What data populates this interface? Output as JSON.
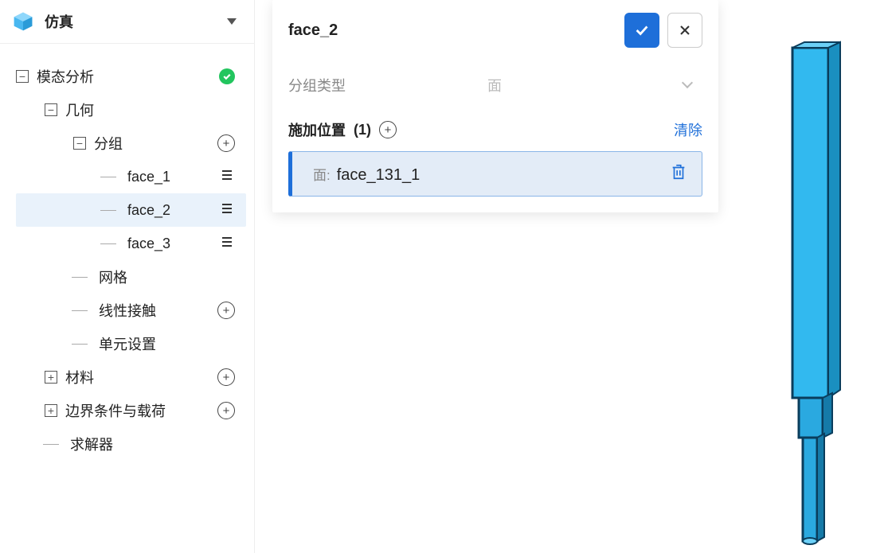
{
  "sidebar": {
    "title": "仿真",
    "root": {
      "label": "模态分析",
      "children": [
        {
          "label": "几何",
          "children_group": {
            "label": "分组",
            "faces": [
              "face_1",
              "face_2",
              "face_3"
            ]
          },
          "siblings": [
            "网格",
            "线性接触",
            "单元设置"
          ]
        },
        {
          "label": "材料"
        },
        {
          "label": "边界条件与载荷"
        },
        {
          "label": "求解器"
        }
      ]
    }
  },
  "panel": {
    "title": "face_2",
    "group_type_label": "分组类型",
    "group_type_value": "面",
    "section_title": "施加位置",
    "section_count": "(1)",
    "clear_label": "清除",
    "location_prefix": "面:",
    "location_name": "face_131_1"
  }
}
